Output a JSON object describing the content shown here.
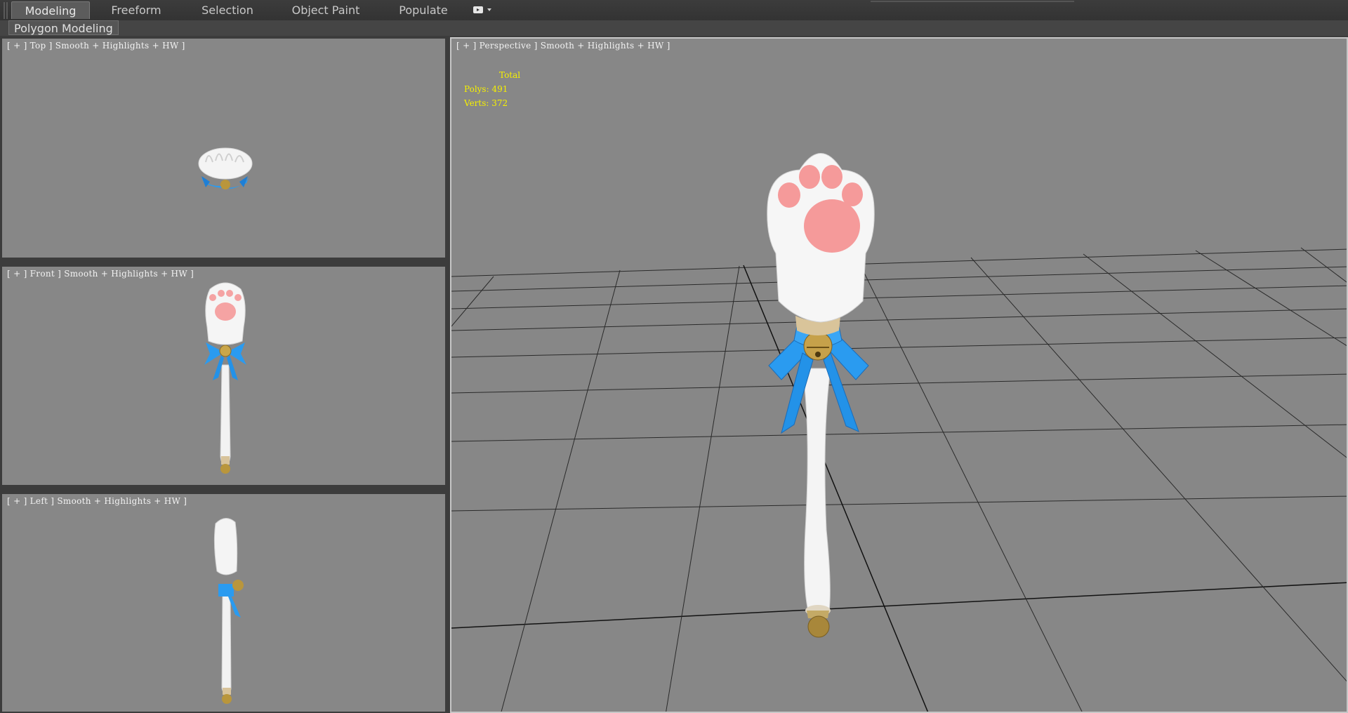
{
  "ribbon": {
    "tabs": [
      "Modeling",
      "Freeform",
      "Selection",
      "Object Paint",
      "Populate"
    ],
    "active_tab": "Modeling",
    "panel_label": "Polygon Modeling"
  },
  "viewports": {
    "top": {
      "label": "[ + ] Top ] Smooth + Highlights + HW ]"
    },
    "front": {
      "label": "[ + ] Front ] Smooth + Highlights + HW ]"
    },
    "left": {
      "label": "[ + ] Left ] Smooth + Highlights + HW ]"
    },
    "perspective": {
      "label": "[ + ] Perspective ] Smooth + Highlights + HW ]"
    }
  },
  "stats": {
    "header": "Total",
    "polys_label": "Polys:",
    "polys": "491",
    "verts_label": "Verts:",
    "verts": "372"
  },
  "colors": {
    "viewport_bg": "#878787",
    "grid": "#2a2a2a",
    "paw_white": "#f4f4f4",
    "paw_pad": "#f5a3a3",
    "ribbon_blue": "#2a9bf0",
    "bell_gold": "#b9963c",
    "stats_text": "#f6f000"
  }
}
